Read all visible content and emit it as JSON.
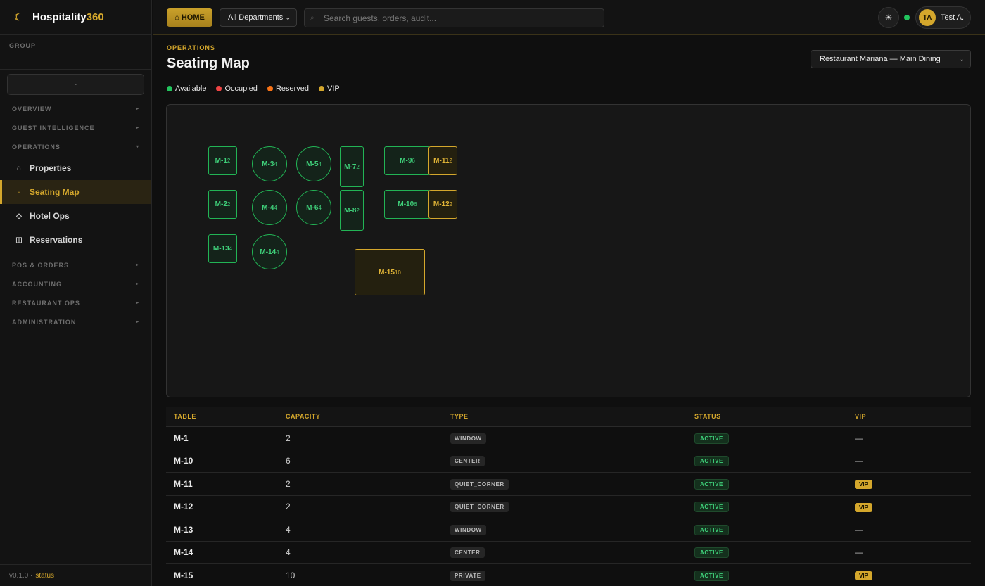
{
  "brand": {
    "logo_glyph": "☾",
    "name": "Hospitality",
    "accent": "360"
  },
  "sidebar": {
    "group_label": "GROUP",
    "group_value": "—",
    "property_placeholder": "-",
    "sections": {
      "overview": "OVERVIEW",
      "guest_intelligence": "GUEST INTELLIGENCE",
      "operations": "OPERATIONS",
      "pos_orders": "POS & ORDERS",
      "accounting": "ACCOUNTING",
      "restaurant_ops": "RESTAURANT OPS",
      "administration": "ADMINISTRATION"
    },
    "items": [
      {
        "label": "Properties",
        "icon": "⌂"
      },
      {
        "label": "Seating Map",
        "icon": "▫"
      },
      {
        "label": "Hotel Ops",
        "icon": "◇"
      },
      {
        "label": "Reservations",
        "icon": "◫"
      }
    ],
    "version": "v0.1.0 ·",
    "status_link": "status"
  },
  "topbar": {
    "home_label": "⌂ HOME",
    "department": "All Departments",
    "search_placeholder": "Search guests, orders, audit...",
    "theme_icon": "☀",
    "user_initials": "TA",
    "user_name": "Test A."
  },
  "page": {
    "eyebrow": "OPERATIONS",
    "title": "Seating Map",
    "venue": "Restaurant Mariana — Main Dining"
  },
  "legend": [
    {
      "label": "Available",
      "color": "#22c55e"
    },
    {
      "label": "Occupied",
      "color": "#ef4444"
    },
    {
      "label": "Reserved",
      "color": "#f97316"
    },
    {
      "label": "VIP",
      "color": "#d4a72c"
    }
  ],
  "floor_tables": [
    {
      "id": "M-1",
      "cap": "2"
    },
    {
      "id": "M-2",
      "cap": "2"
    },
    {
      "id": "M-13",
      "cap": "4"
    },
    {
      "id": "M-3",
      "cap": "4"
    },
    {
      "id": "M-4",
      "cap": "4"
    },
    {
      "id": "M-14",
      "cap": "4"
    },
    {
      "id": "M-5",
      "cap": "4"
    },
    {
      "id": "M-6",
      "cap": "4"
    },
    {
      "id": "M-7",
      "cap": "2"
    },
    {
      "id": "M-8",
      "cap": "2"
    },
    {
      "id": "M-9",
      "cap": "6"
    },
    {
      "id": "M-10",
      "cap": "6"
    },
    {
      "id": "M-11",
      "cap": "2"
    },
    {
      "id": "M-12",
      "cap": "2"
    },
    {
      "id": "M-15",
      "cap": "10"
    }
  ],
  "table": {
    "headers": {
      "table": "TABLE",
      "capacity": "CAPACITY",
      "type": "TYPE",
      "status": "STATUS",
      "vip": "VIP"
    },
    "rows": [
      {
        "table": "M-1",
        "capacity": "2",
        "type": "WINDOW",
        "status": "ACTIVE",
        "vip": "—"
      },
      {
        "table": "M-10",
        "capacity": "6",
        "type": "CENTER",
        "status": "ACTIVE",
        "vip": "—"
      },
      {
        "table": "M-11",
        "capacity": "2",
        "type": "QUIET_CORNER",
        "status": "ACTIVE",
        "vip": "VIP"
      },
      {
        "table": "M-12",
        "capacity": "2",
        "type": "QUIET_CORNER",
        "status": "ACTIVE",
        "vip": "VIP"
      },
      {
        "table": "M-13",
        "capacity": "4",
        "type": "WINDOW",
        "status": "ACTIVE",
        "vip": "—"
      },
      {
        "table": "M-14",
        "capacity": "4",
        "type": "CENTER",
        "status": "ACTIVE",
        "vip": "—"
      },
      {
        "table": "M-15",
        "capacity": "10",
        "type": "PRIVATE",
        "status": "ACTIVE",
        "vip": "VIP"
      }
    ]
  }
}
